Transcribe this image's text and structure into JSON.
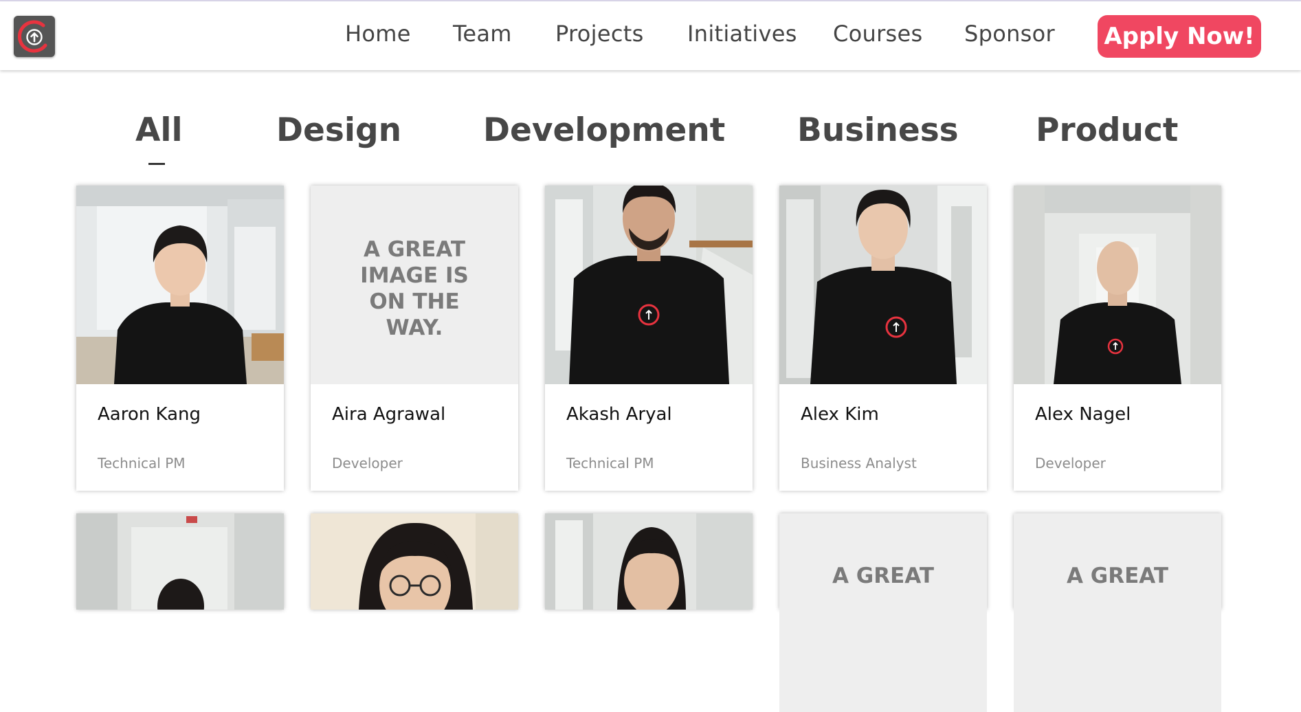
{
  "nav": {
    "logo_icon": "logo-arrow-up-circle-icon",
    "links": [
      "Home",
      "Team",
      "Projects",
      "Initiatives",
      "Courses",
      "Sponsor"
    ],
    "apply_label": "Apply Now!"
  },
  "filters": {
    "tabs": [
      "All",
      "Design",
      "Development",
      "Business",
      "Product"
    ],
    "active": "All"
  },
  "placeholder_lines": [
    "A GREAT",
    "IMAGE IS",
    "ON THE",
    "WAY."
  ],
  "members": [
    {
      "name": "Aaron Kang",
      "role": "Technical PM",
      "has_photo": true
    },
    {
      "name": "Aira Agrawal",
      "role": "Developer",
      "has_photo": false
    },
    {
      "name": "Akash Aryal",
      "role": "Technical PM",
      "has_photo": true
    },
    {
      "name": "Alex Kim",
      "role": "Business Analyst",
      "has_photo": true
    },
    {
      "name": "Alex Nagel",
      "role": "Developer",
      "has_photo": true
    }
  ],
  "row2_placeholder_text": "A GREAT",
  "colors": {
    "accent": "#f04761",
    "text": "#444444",
    "placeholder_bg": "#eeeeee",
    "shirt": "#141414",
    "logo_red": "#e8333f"
  }
}
